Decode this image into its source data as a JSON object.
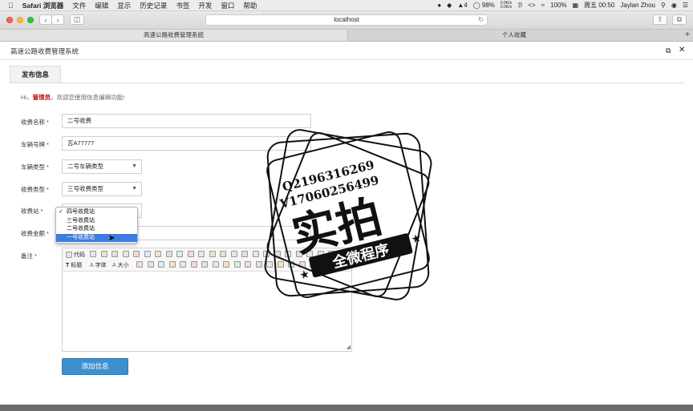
{
  "menubar": {
    "app": "Safari 浏览器",
    "items": [
      "文件",
      "编辑",
      "显示",
      "历史记录",
      "书签",
      "开发",
      "窗口",
      "帮助"
    ],
    "status": {
      "notif_count": "4",
      "battery": "98%",
      "net_up": "0.0K/s",
      "net_down": "0.0K/s",
      "brightness": "100%",
      "datetime": "周五 00:50",
      "user": "Jaylan Zhou"
    }
  },
  "browser": {
    "url": "localhost",
    "tabs": [
      {
        "label": "高速公路收费管理系统",
        "active": true
      },
      {
        "label": "个人收藏",
        "active": false
      }
    ],
    "new_tab": "+"
  },
  "page": {
    "title": "高速公路收费管理系统",
    "tab": "发布信息",
    "welcome_prefix": "Hi，",
    "welcome_user": "管理员",
    "welcome_suffix": "，欢迎您使用信息编辑功能!",
    "fields": {
      "name": {
        "label": "收费名称",
        "value": "二号收费"
      },
      "plate": {
        "label": "车辆号牌",
        "value": "吉A77777"
      },
      "vehicle_type": {
        "label": "车辆类型",
        "value": "二号车辆类型"
      },
      "charge_type": {
        "label": "收费类型",
        "value": "三号收费类型"
      },
      "station": {
        "label": "收费站",
        "options": [
          "四号收费站",
          "三号收费站",
          "二号收费站",
          "一号收费站"
        ],
        "checked_index": 0,
        "highlighted_index": 3
      },
      "amount": {
        "label": "收费金额"
      },
      "remark": {
        "label": "备注"
      }
    },
    "required_mark": "*",
    "editor_labels": {
      "code": "代码",
      "heading": "标题",
      "font": "字体",
      "size": "大小"
    },
    "submit": "添加信息"
  },
  "watermark": {
    "line1": "Q2196316269",
    "line2": "V17060256499",
    "big": "实拍",
    "banner": "全微程序"
  }
}
